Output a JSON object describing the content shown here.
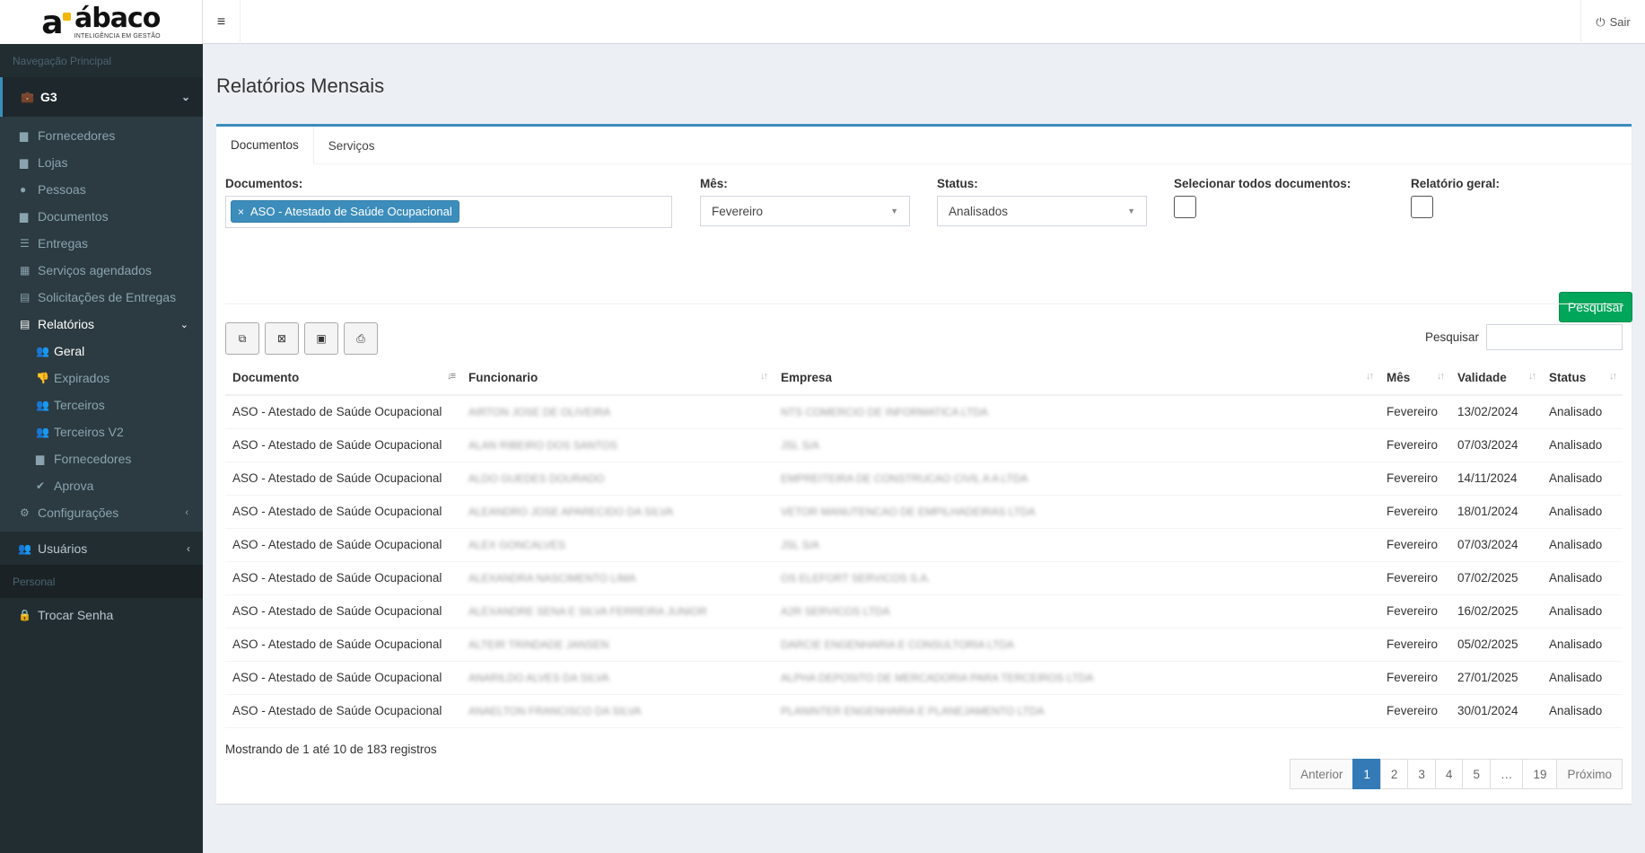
{
  "brand": {
    "name": "ábaco",
    "tagline": "INTELIGÊNCIA EM GESTÃO",
    "accent": "#3c8dbc"
  },
  "sidebar": {
    "nav_header": "Navegação Principal",
    "group": {
      "label": "G3"
    },
    "items": [
      {
        "label": "Fornecedores",
        "icon": "book-icon"
      },
      {
        "label": "Lojas",
        "icon": "book-icon"
      },
      {
        "label": "Pessoas",
        "icon": "user-icon"
      },
      {
        "label": "Documentos",
        "icon": "book-icon"
      },
      {
        "label": "Entregas",
        "icon": "list-icon"
      },
      {
        "label": "Serviços agendados",
        "icon": "calendar-icon"
      },
      {
        "label": "Solicitações de Entregas",
        "icon": "document-icon"
      }
    ],
    "relatorios": {
      "label": "Relatórios",
      "children": [
        {
          "label": "Geral",
          "icon": "users-icon"
        },
        {
          "label": "Expirados",
          "icon": "thumbs-down-icon"
        },
        {
          "label": "Terceiros",
          "icon": "users-icon"
        },
        {
          "label": "Terceiros V2",
          "icon": "users-icon"
        },
        {
          "label": "Fornecedores",
          "icon": "book-icon"
        },
        {
          "label": "Aprova",
          "icon": "check-icon"
        }
      ]
    },
    "configuracoes": {
      "label": "Configurações"
    },
    "usuarios": {
      "label": "Usuários"
    },
    "personal_header": "Personal",
    "trocar_senha": {
      "label": "Trocar Senha"
    }
  },
  "topbar": {
    "logout_label": "Sair"
  },
  "page": {
    "title": "Relatórios Mensais"
  },
  "tabs": [
    {
      "label": "Documentos"
    },
    {
      "label": "Serviços"
    }
  ],
  "filters": {
    "documentos": {
      "label": "Documentos:",
      "selected": "ASO - Atestado de Saúde Ocupacional"
    },
    "mes": {
      "label": "Mês:",
      "value": "Fevereiro"
    },
    "status": {
      "label": "Status:",
      "value": "Analisados"
    },
    "selecionar_todos": {
      "label": "Selecionar todos documentos:",
      "checked": false
    },
    "relatorio_geral": {
      "label": "Relatório geral:",
      "checked": false
    },
    "search_button": "Pesquisar"
  },
  "table_search_label": "Pesquisar",
  "table": {
    "columns": [
      "Documento",
      "Funcionario",
      "Empresa",
      "Mês",
      "Validade",
      "Status"
    ],
    "rows": [
      [
        "ASO - Atestado de Saúde Ocupacional",
        "AIRTON JOSE DE OLIVEIRA",
        "NTS COMERCIO DE INFORMATICA LTDA",
        "Fevereiro",
        "13/02/2024",
        "Analisado"
      ],
      [
        "ASO - Atestado de Saúde Ocupacional",
        "ALAN RIBEIRO DOS SANTOS",
        "JSL S/A",
        "Fevereiro",
        "07/03/2024",
        "Analisado"
      ],
      [
        "ASO - Atestado de Saúde Ocupacional",
        "ALDO GUEDES DOURADO",
        "EMPREITEIRA DE CONSTRUCAO CIVIL A A LTDA",
        "Fevereiro",
        "14/11/2024",
        "Analisado"
      ],
      [
        "ASO - Atestado de Saúde Ocupacional",
        "ALEANDRO JOSE APARECIDO DA SILVA",
        "VETOR MANUTENCAO DE EMPILHADEIRAS LTDA",
        "Fevereiro",
        "18/01/2024",
        "Analisado"
      ],
      [
        "ASO - Atestado de Saúde Ocupacional",
        "ALEX GONCALVES",
        "JSL S/A",
        "Fevereiro",
        "07/03/2024",
        "Analisado"
      ],
      [
        "ASO - Atestado de Saúde Ocupacional",
        "ALEXANDRA NASCIMENTO LIMA",
        "OS ELEFORT SERVICOS S.A.",
        "Fevereiro",
        "07/02/2025",
        "Analisado"
      ],
      [
        "ASO - Atestado de Saúde Ocupacional",
        "ALEXANDRE SENA E SILVA FERREIRA JUNIOR",
        "A2R SERVICOS LTDA",
        "Fevereiro",
        "16/02/2025",
        "Analisado"
      ],
      [
        "ASO - Atestado de Saúde Ocupacional",
        "ALTEIR TRINDADE JANSEN",
        "DARCIE ENGENHARIA E CONSULTORIA LTDA",
        "Fevereiro",
        "05/02/2025",
        "Analisado"
      ],
      [
        "ASO - Atestado de Saúde Ocupacional",
        "ANARILDO ALVES DA SILVA",
        "ALPHA DEPOSITO DE MERCADORIA PARA TERCEIROS LTDA",
        "Fevereiro",
        "27/01/2025",
        "Analisado"
      ],
      [
        "ASO - Atestado de Saúde Ocupacional",
        "ANAELTON FRANCISCO DA SILVA",
        "PLANINTER ENGENHARIA E PLANEJAMENTO LTDA",
        "Fevereiro",
        "30/01/2024",
        "Analisado"
      ]
    ]
  },
  "info_text": "Mostrando de 1 até 10 de 183 registros",
  "pagination": {
    "prev": "Anterior",
    "pages": [
      "1",
      "2",
      "3",
      "4",
      "5",
      "…",
      "19"
    ],
    "active": "1",
    "next": "Próximo"
  }
}
